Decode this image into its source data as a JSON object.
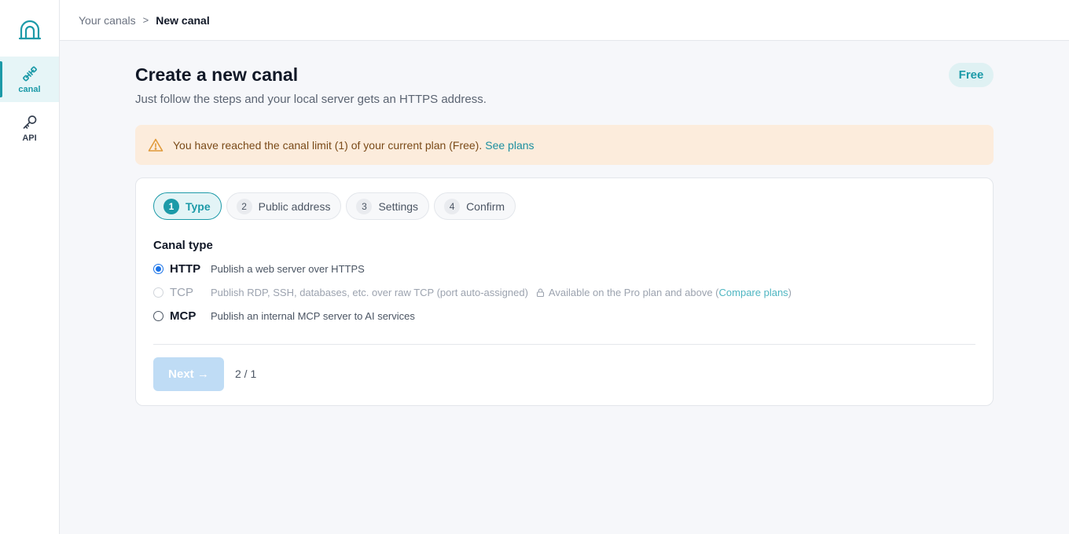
{
  "sidebar": {
    "logo_icon": "arch-logo-icon",
    "items": [
      {
        "label": "canal",
        "icon": "plug-icon",
        "active": true
      },
      {
        "label": "API",
        "icon": "key-icon",
        "active": false
      }
    ]
  },
  "breadcrumb": {
    "parent": "Your canals",
    "separator": ">",
    "current": "New canal"
  },
  "header": {
    "title": "Create a new canal",
    "subtitle": "Just follow the steps and your local server gets an HTTPS address.",
    "plan_badge": "Free"
  },
  "alert": {
    "icon": "warning-icon",
    "message": "You have reached the canal limit (1) of your current plan (Free).",
    "link": "See plans"
  },
  "steps": [
    {
      "num": "1",
      "label": "Type",
      "active": true
    },
    {
      "num": "2",
      "label": "Public address",
      "active": false
    },
    {
      "num": "3",
      "label": "Settings",
      "active": false
    },
    {
      "num": "4",
      "label": "Confirm",
      "active": false
    }
  ],
  "canal_type": {
    "title": "Canal type",
    "options": [
      {
        "name": "HTTP",
        "desc": "Publish a web server over HTTPS",
        "checked": true,
        "disabled": false
      },
      {
        "name": "TCP",
        "desc": "Publish RDP, SSH, databases, etc. over raw TCP (port auto-assigned)",
        "checked": false,
        "disabled": true,
        "lock_icon": "lock-icon",
        "avail_prefix": "Available on the Pro plan and above (",
        "avail_link": "Compare plans",
        "avail_suffix": ")"
      },
      {
        "name": "MCP",
        "desc": "Publish an internal MCP server to AI services",
        "checked": false,
        "disabled": false
      }
    ]
  },
  "footer": {
    "next_label": "Next →",
    "page_count": "2 / 1"
  },
  "colors": {
    "accent": "#1c9aa8",
    "alert_bg": "#fcecdc",
    "radio_checked": "#1a73e8",
    "next_disabled": "#bfdcf5"
  }
}
